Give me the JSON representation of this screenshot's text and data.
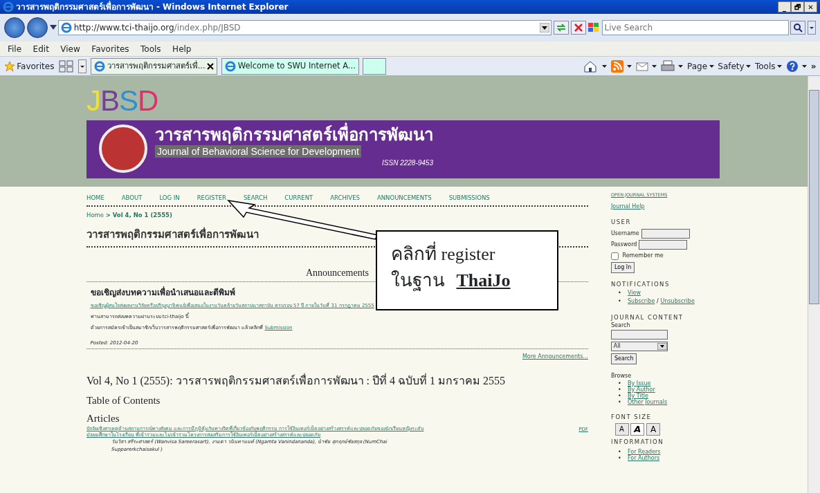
{
  "window": {
    "title": "วารสารพฤติกรรมศาสตร์เพื่อการพัฒนา - Windows Internet Explorer",
    "controls": [
      "_",
      "🗗",
      "✕"
    ]
  },
  "address_bar": {
    "url_host": "http://www.tci-thaijo.org",
    "url_path": "/index.php/JBSD",
    "search_placeholder": "Live Search"
  },
  "menu": [
    "File",
    "Edit",
    "View",
    "Favorites",
    "Tools",
    "Help"
  ],
  "favorites_label": "Favorites",
  "tabs": [
    {
      "label": "วารสารพฤติกรรมศาสตร์เพื่...",
      "selected": true
    },
    {
      "label": "Welcome to SWU Internet A...",
      "selected": false
    }
  ],
  "command_bar": [
    {
      "kind": "home"
    },
    {
      "kind": "feeds"
    },
    {
      "kind": "mail"
    },
    {
      "kind": "print"
    },
    {
      "kind": "menu",
      "label": "Page"
    },
    {
      "kind": "menu",
      "label": "Safety"
    },
    {
      "kind": "menu",
      "label": "Tools"
    },
    {
      "kind": "help"
    },
    {
      "kind": "more",
      "label": "»"
    }
  ],
  "page": {
    "logo": {
      "letters": [
        {
          "text": "J",
          "color": "#f5e12a"
        },
        {
          "text": "B",
          "color": "#7a3d9a"
        },
        {
          "text": "S",
          "color": "#2f8fd0"
        },
        {
          "text": "D",
          "color": "#e0306a"
        }
      ]
    },
    "banner": {
      "title": "วารสารพฤติกรรมศาสตร์เพื่อการพัฒนา",
      "subtitle": "Journal of Behavioral Science for Development",
      "issn": "ISSN 2228-9453"
    },
    "nav": [
      "HOME",
      "ABOUT",
      "LOG IN",
      "REGISTER",
      "SEARCH",
      "CURRENT",
      "ARCHIVES",
      "ANNOUNCEMENTS",
      "SUBMISSIONS"
    ],
    "breadcrumb": {
      "home": "Home",
      "separator": ">",
      "current": "Vol 4, No 1 (2555)"
    },
    "heading": "วารสารพฤติกรรมศาสตร์เพื่อการพัฒนา",
    "announcements": {
      "heading": "Announcements",
      "items": [
        {
          "title": "ขอเชิญส่งบทความเพื่อนำเสนอและตีพิมพ์",
          "link": "ขอเชิญผู้สนใจส่งผลงานวิจัยหรือปริญญานิพนธ์เพื่อเสนอในงานวันคล้ายวันสถาปนาสถาบัน ครบรอบ 57 ปี ภายในวันที่ 31 กรกฎาคม 2555",
          "line": "ท่านสามารถส่งบทความผ่านระบบ tci-thaijo นี้",
          "line2": "ด้วยการสมัครเข้าเป็นสมาชิกเว็บวารสารพฤติกรรมศาสตร์เพื่อการพัฒนา แล้วคลิกที่",
          "line2_link": "Submission",
          "posted": "Posted: 2012-04-20"
        }
      ],
      "more": "More Announcements..."
    },
    "issue_title": "Vol 4, No 1 (2555): วารสารพฤติกรรมศาสตร์เพื่อการพัฒนา : ปีที่ 4 ฉบับที่ 1 มกราคม 2555",
    "toc_heading": "Table of Contents",
    "section": "Articles",
    "articles": [
      {
        "title": "ปัจจัยเชิงสาเหตุด้านสถานการณ์ทางสังคม และการมีภูมิคุ้มกันทางจิตที่เกี่ยวข้องกับพฤติกรรม การใช้อินเทอร์เน็ตอย่างสร้างสรรค์และปลอดภัยของนักเรียนหญิงระดับมัธยมศึกษาในโรงเรียน ที่เข้าร่วมและไม่เข้าร่วมโครงการส่งเสริมการใช้อินเทอร์เน็ตอย่างสร้างสรรค์และปลอดภัย",
        "galley": "PDF",
        "authors": "วันวิสา สรีระศาสตร์ (Wanvisa Sareerasart), งามตา วนินทานนท์ (Ngamta Vanindananda), นำชัย ศุภฤกษ์ชัยสกุล (NumChai Supparerkchaisakul )"
      }
    ],
    "sidebar": {
      "bullet": "•",
      "ojs": "OPEN JOURNAL SYSTEMS",
      "help": "Journal Help",
      "user": {
        "heading": "USER",
        "username": "Username",
        "password": "Password",
        "remember": "Remember me",
        "remember_checked": false,
        "login": "Log In"
      },
      "notifications": {
        "heading": "NOTIFICATIONS",
        "view": "View",
        "subscribe": "Subscribe",
        "sep": "/",
        "unsubscribe": "Unsubscribe"
      },
      "content": {
        "heading": "JOURNAL CONTENT",
        "search_label": "Search",
        "scope": "All",
        "search_button": "Search",
        "browse": "Browse",
        "browse_links": [
          "By Issue",
          "By Author",
          "By Title",
          "Other Journals"
        ]
      },
      "font_size": {
        "heading": "FONT SIZE",
        "buttons": [
          {
            "kind": "decrease",
            "label": "A"
          },
          {
            "kind": "default",
            "label": "A"
          },
          {
            "kind": "increase",
            "label": "A"
          }
        ]
      },
      "information": {
        "heading": "INFORMATION",
        "links": [
          "For Readers",
          "For Authors"
        ]
      }
    }
  },
  "callout": {
    "line1": "คลิกที่ register",
    "line2": "ในฐาน",
    "line2_bold": "ThaiJo"
  }
}
